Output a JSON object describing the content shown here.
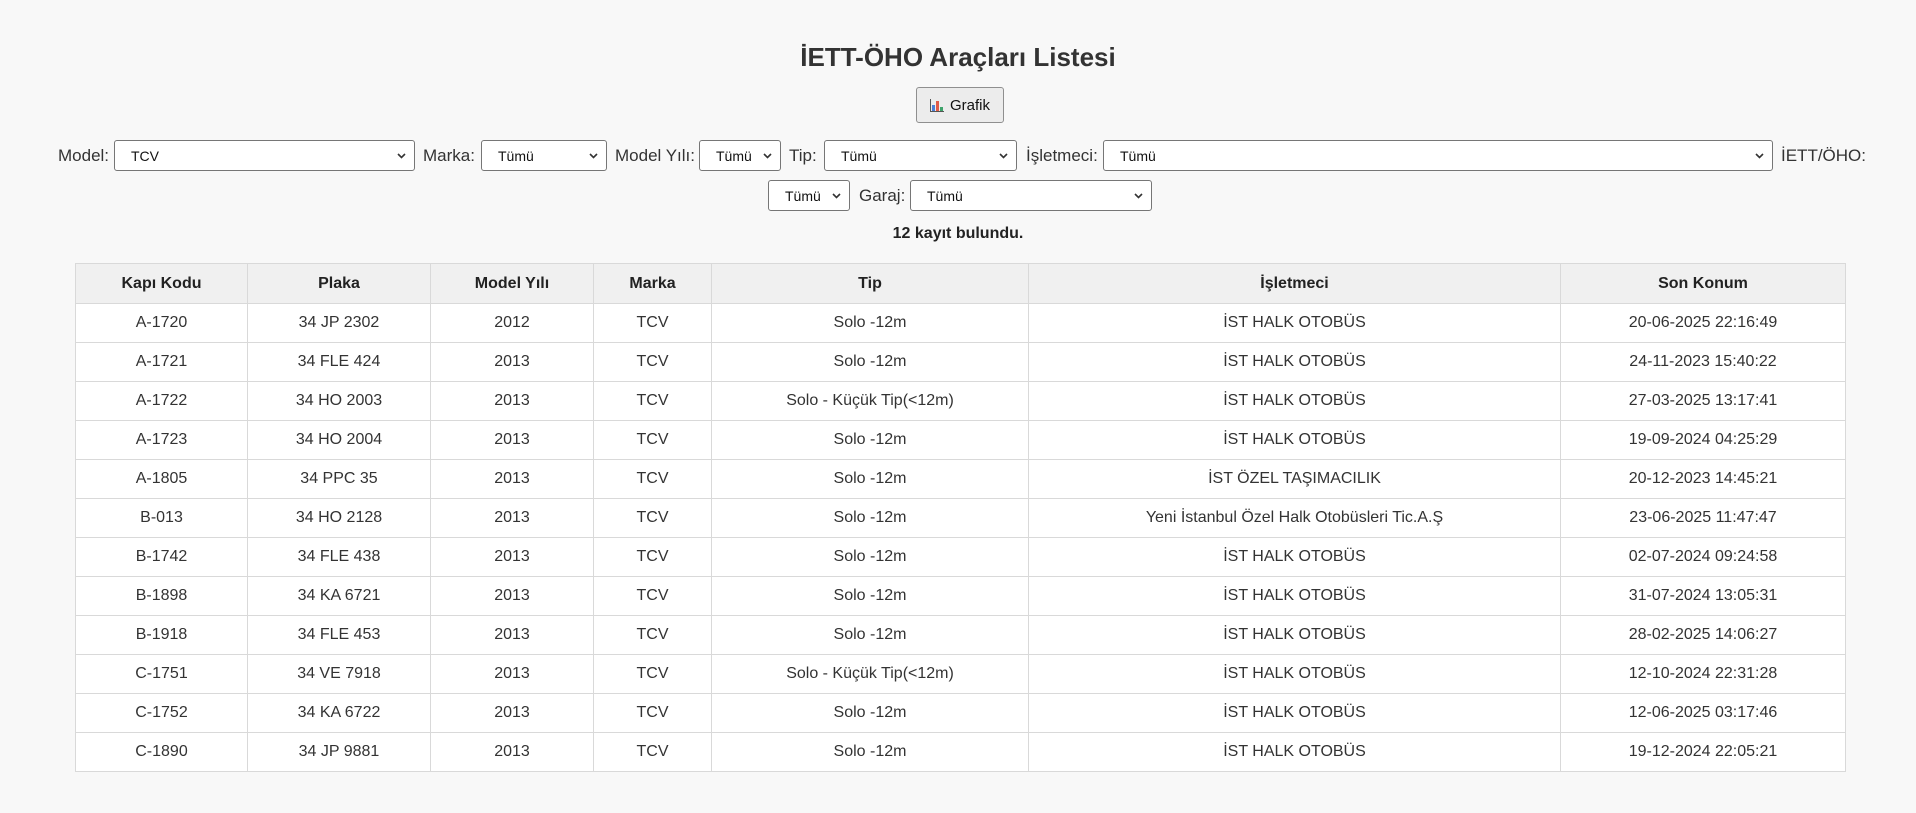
{
  "header": {
    "title": "İETT-ÖHO Araçları Listesi"
  },
  "toolbar": {
    "chart_button_label": "Grafik",
    "chart_icon": "bar-chart-icon"
  },
  "filters": {
    "model": {
      "label": "Model:",
      "value": "TCV"
    },
    "marka": {
      "label": "Marka:",
      "value": "Tümü"
    },
    "model_yili": {
      "label": "Model Yılı:",
      "value": "Tümü"
    },
    "tip": {
      "label": "Tip:",
      "value": "Tümü"
    },
    "isletmeci": {
      "label": "İşletmeci:",
      "value": "Tümü"
    },
    "iett_oho": {
      "label": "İETT/ÖHO:",
      "value": "Tümü"
    },
    "garaj": {
      "label": "Garaj:",
      "value": "Tümü"
    }
  },
  "result": {
    "count_text": "12 kayıt bulundu."
  },
  "table": {
    "columns": [
      "Kapı Kodu",
      "Plaka",
      "Model Yılı",
      "Marka",
      "Tip",
      "İşletmeci",
      "Son Konum"
    ],
    "rows": [
      [
        "A-1720",
        "34 JP 2302",
        "2012",
        "TCV",
        "Solo -12m",
        "İST HALK OTOBÜS",
        "20-06-2025 22:16:49"
      ],
      [
        "A-1721",
        "34 FLE 424",
        "2013",
        "TCV",
        "Solo -12m",
        "İST HALK OTOBÜS",
        "24-11-2023 15:40:22"
      ],
      [
        "A-1722",
        "34 HO 2003",
        "2013",
        "TCV",
        "Solo - Küçük Tip(<12m)",
        "İST HALK OTOBÜS",
        "27-03-2025 13:17:41"
      ],
      [
        "A-1723",
        "34 HO 2004",
        "2013",
        "TCV",
        "Solo -12m",
        "İST HALK OTOBÜS",
        "19-09-2024 04:25:29"
      ],
      [
        "A-1805",
        "34 PPC 35",
        "2013",
        "TCV",
        "Solo -12m",
        "İST ÖZEL TAŞIMACILIK",
        "20-12-2023 14:45:21"
      ],
      [
        "B-013",
        "34 HO 2128",
        "2013",
        "TCV",
        "Solo -12m",
        "Yeni İstanbul Özel Halk Otobüsleri Tic.A.Ş",
        "23-06-2025 11:47:47"
      ],
      [
        "B-1742",
        "34 FLE 438",
        "2013",
        "TCV",
        "Solo -12m",
        "İST HALK OTOBÜS",
        "02-07-2024 09:24:58"
      ],
      [
        "B-1898",
        "34 KA 6721",
        "2013",
        "TCV",
        "Solo -12m",
        "İST HALK OTOBÜS",
        "31-07-2024 13:05:31"
      ],
      [
        "B-1918",
        "34 FLE 453",
        "2013",
        "TCV",
        "Solo -12m",
        "İST HALK OTOBÜS",
        "28-02-2025 14:06:27"
      ],
      [
        "C-1751",
        "34 VE 7918",
        "2013",
        "TCV",
        "Solo - Küçük Tip(<12m)",
        "İST HALK OTOBÜS",
        "12-10-2024 22:31:28"
      ],
      [
        "C-1752",
        "34 KA 6722",
        "2013",
        "TCV",
        "Solo -12m",
        "İST HALK OTOBÜS",
        "12-06-2025 03:17:46"
      ],
      [
        "C-1890",
        "34 JP 9881",
        "2013",
        "TCV",
        "Solo -12m",
        "İST HALK OTOBÜS",
        "19-12-2024 22:05:21"
      ]
    ]
  }
}
